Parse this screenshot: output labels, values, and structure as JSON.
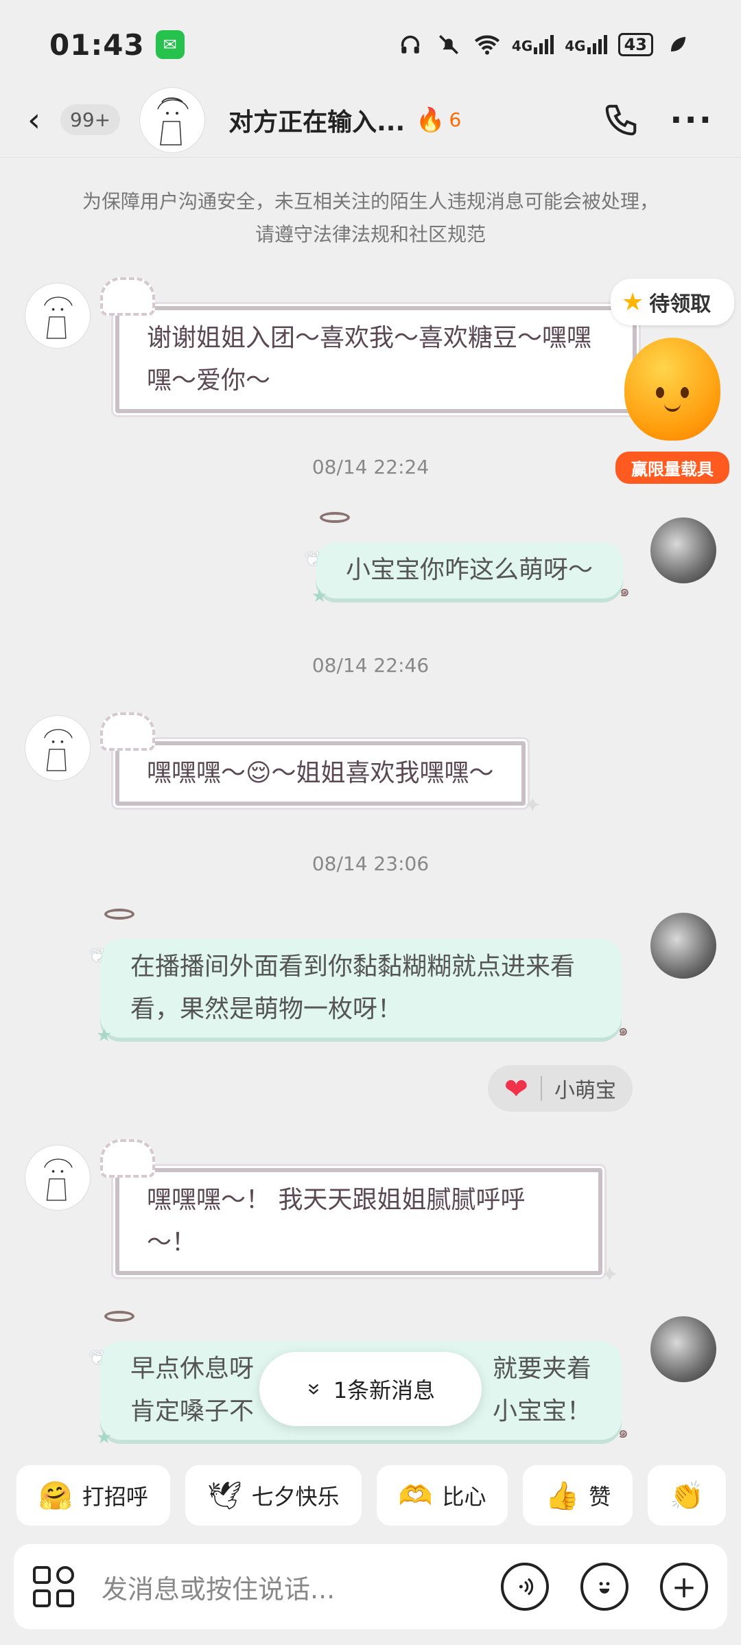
{
  "status_bar": {
    "time": "01:43",
    "net1": "4G",
    "net2": "4G",
    "battery": "43"
  },
  "header": {
    "unread": "99+",
    "title": "对方正在输入...",
    "streak": "6"
  },
  "notice": "为保障用户沟通安全，未互相关注的陌生人违规消息可能会被处理，请遵守法律法规和社区规范",
  "reward": {
    "pill": "待领取",
    "label": "赢限量载具"
  },
  "messages": [
    {
      "side": "left",
      "text": "谢谢姐姐入团～喜欢我～喜欢糖豆～嘿嘿嘿～爱你～"
    },
    {
      "side": "time",
      "text": "08/14 22:24"
    },
    {
      "side": "right",
      "text": "小宝宝你咋这么萌呀～"
    },
    {
      "side": "time",
      "text": "08/14 22:46"
    },
    {
      "side": "left",
      "text_a": "嘿嘿嘿～",
      "emoji": "😌",
      "text_b": "～姐姐喜欢我嘿嘿～"
    },
    {
      "side": "time",
      "text": "08/14 23:06"
    },
    {
      "side": "right",
      "text": "在播播间外面看到你黏黏糊糊就点进来看看，果然是萌物一枚呀！"
    },
    {
      "side": "left",
      "text": "嘿嘿嘿～！ 我天天跟姐姐腻腻呼呼～！"
    },
    {
      "side": "right",
      "line1_a": "早点休息呀",
      "line1_b": "就要夹着",
      "line2_a": "肯定嗓子不",
      "line2_b": "小宝宝！"
    }
  ],
  "reaction": {
    "name": "小萌宝"
  },
  "new_message_pill": "1条新消息",
  "quick_replies": [
    {
      "label": "打招呼",
      "icon": "wave-emoji-icon"
    },
    {
      "label": "七夕快乐",
      "icon": "bird-emoji-icon"
    },
    {
      "label": "比心",
      "icon": "heart-hands-emoji-icon"
    },
    {
      "label": "赞",
      "icon": "thumbs-up-emoji-icon"
    },
    {
      "label": "",
      "icon": "clap-emoji-icon"
    }
  ],
  "input": {
    "placeholder": "发消息或按住说话..."
  },
  "colors": {
    "accent_orange": "#ff5a1f",
    "bubble_right": "#e0f6ef",
    "heart": "#f0324a"
  }
}
